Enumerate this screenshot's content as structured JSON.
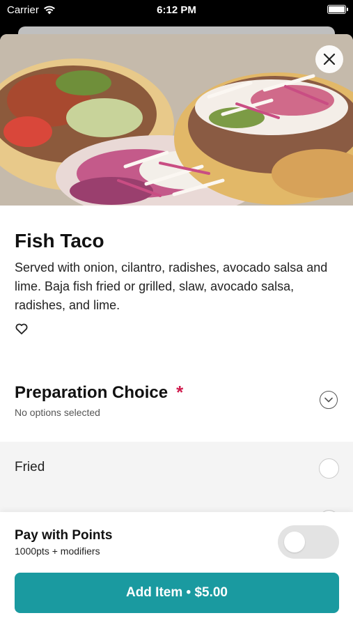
{
  "status_bar": {
    "carrier": "Carrier",
    "time": "6:12 PM"
  },
  "item": {
    "title": "Fish Taco",
    "description": "Served with onion, cilantro, radishes, avocado salsa and lime. Baja fish fried or grilled, slaw, avocado salsa, radishes, and lime."
  },
  "icons": {
    "close": "close-icon",
    "favorite": "heart-icon",
    "expand": "chevron-down-icon",
    "wifi": "wifi-icon",
    "battery": "battery-icon"
  },
  "preparation": {
    "title": "Preparation Choice",
    "required_mark": "*",
    "status": "No options selected",
    "options": [
      {
        "label": "Fried",
        "selected": false
      }
    ]
  },
  "points": {
    "title": "Pay with Points",
    "subtitle": "1000pts + modifiers",
    "enabled": false
  },
  "cta": {
    "label": "Add Item • $5.00"
  },
  "colors": {
    "accent": "#1a9aa0",
    "required": "#d01c4e",
    "options_bg": "#f4f4f4"
  }
}
